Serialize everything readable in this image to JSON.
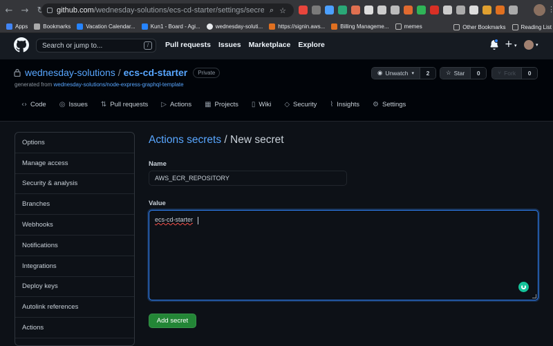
{
  "browser": {
    "url_domain": "github.com",
    "url_path": "/wednesday-solutions/ecs-cd-starter/settings/secrets/actions/...",
    "bookmarks": [
      "Apps",
      "Bookmarks",
      "Vacation Calendar...",
      "Kun1 - Board - Agi...",
      "wednesday-soluti...",
      "https://signin.aws...",
      "Billing Manageme...",
      "memes"
    ],
    "bookmarks_right": [
      "Other Bookmarks",
      "Reading List"
    ],
    "extension_colors": [
      "#e8453c",
      "#7a7a7a",
      "#4ca0ff",
      "#2aa877",
      "#e07050",
      "#dddddd",
      "#cccccc",
      "#bbbbbb",
      "#e06a30",
      "#2fb457",
      "#d93025",
      "#cccccc",
      "#aaaaaa",
      "#dddddd",
      "#e0a030",
      "#e07020",
      "#aaaaaa"
    ]
  },
  "header": {
    "search_placeholder": "Search or jump to...",
    "search_shortcut": "/",
    "nav": [
      "Pull requests",
      "Issues",
      "Marketplace",
      "Explore"
    ]
  },
  "repo": {
    "owner": "wednesday-solutions",
    "separator": "/",
    "name": "ecs-cd-starter",
    "visibility": "Private",
    "generated_prefix": "generated from",
    "generated_link": "wednesday-solutions/node-express-graphql-template",
    "unwatch_label": "Unwatch",
    "unwatch_count": "2",
    "star_label": "Star",
    "star_count": "0",
    "fork_label": "Fork",
    "fork_count": "0"
  },
  "tabs": [
    {
      "label": "Code",
      "icon": "code-icon"
    },
    {
      "label": "Issues",
      "icon": "issue-icon"
    },
    {
      "label": "Pull requests",
      "icon": "pull-request-icon"
    },
    {
      "label": "Actions",
      "icon": "play-icon"
    },
    {
      "label": "Projects",
      "icon": "project-icon"
    },
    {
      "label": "Wiki",
      "icon": "book-icon"
    },
    {
      "label": "Security",
      "icon": "shield-icon"
    },
    {
      "label": "Insights",
      "icon": "graph-icon"
    },
    {
      "label": "Settings",
      "icon": "gear-icon"
    }
  ],
  "sidebar": {
    "items": [
      "Options",
      "Manage access",
      "Security & analysis",
      "Branches",
      "Webhooks",
      "Notifications",
      "Integrations",
      "Deploy keys",
      "Autolink references",
      "Actions"
    ]
  },
  "main": {
    "title_crumb": "Actions secrets",
    "title_rest": " / New secret",
    "name_label": "Name",
    "name_value": "AWS_ECR_REPOSITORY",
    "value_label": "Value",
    "value_text": "ecs-cd-starter",
    "submit_label": "Add secret"
  },
  "colors": {
    "accent_blue": "#58a6ff",
    "focus_blue": "#2f81f7",
    "button_green": "#238636",
    "background": "#0d1117"
  }
}
